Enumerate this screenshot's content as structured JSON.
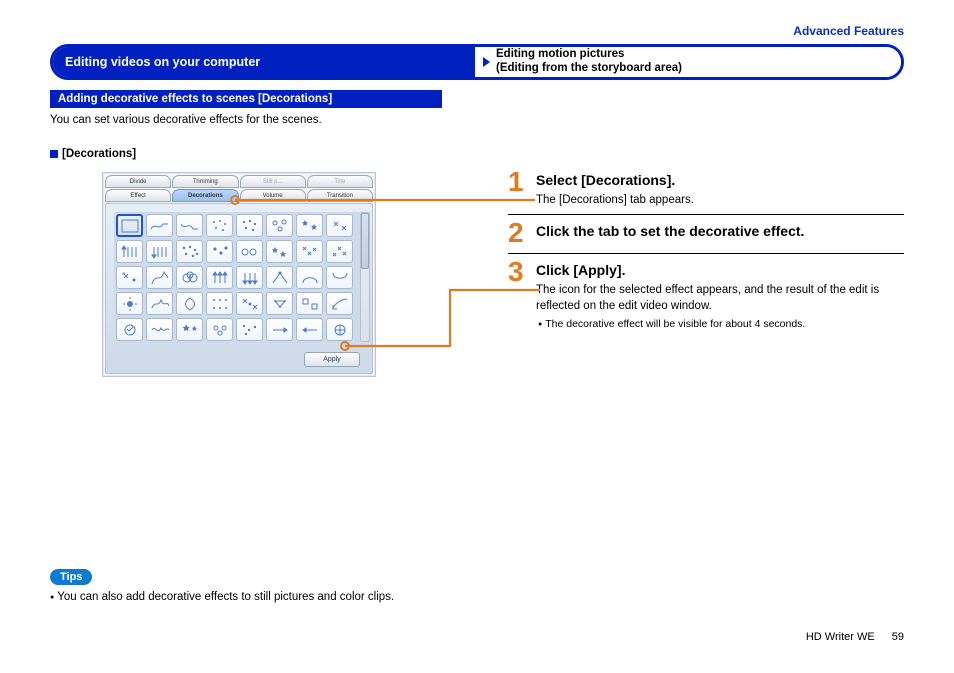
{
  "breadcrumb": "Advanced Features",
  "banner": {
    "left": "Editing videos on your computer",
    "right_line1": "Editing motion pictures",
    "right_line2": "(Editing from the storyboard area)"
  },
  "subheader": "Adding decorative effects to scenes [Decorations]",
  "intro": "You can set various decorative effects for the scenes.",
  "deco_label": "[Decorations]",
  "ui": {
    "tabs_row1": [
      "Divide",
      "Trimming",
      "Still p...",
      "Title"
    ],
    "tabs_row2": [
      "Effect",
      "Decorations",
      "Volume",
      "Transition"
    ],
    "selected_tab": "Decorations",
    "apply_label": "Apply"
  },
  "steps": [
    {
      "num": "1",
      "title": "Select [Decorations].",
      "desc": "The [Decorations] tab appears."
    },
    {
      "num": "2",
      "title": "Click the tab to set the decorative effect."
    },
    {
      "num": "3",
      "title": "Click [Apply].",
      "desc": "The icon for the selected effect appears, and the result of the edit is reflected on the edit video window.",
      "bullet": "The decorative effect will be visible for about 4 seconds."
    }
  ],
  "tips": {
    "label": "Tips",
    "text": "You can also add decorative effects to still pictures and color clips."
  },
  "footer": {
    "product": "HD Writer WE",
    "page": "59"
  }
}
